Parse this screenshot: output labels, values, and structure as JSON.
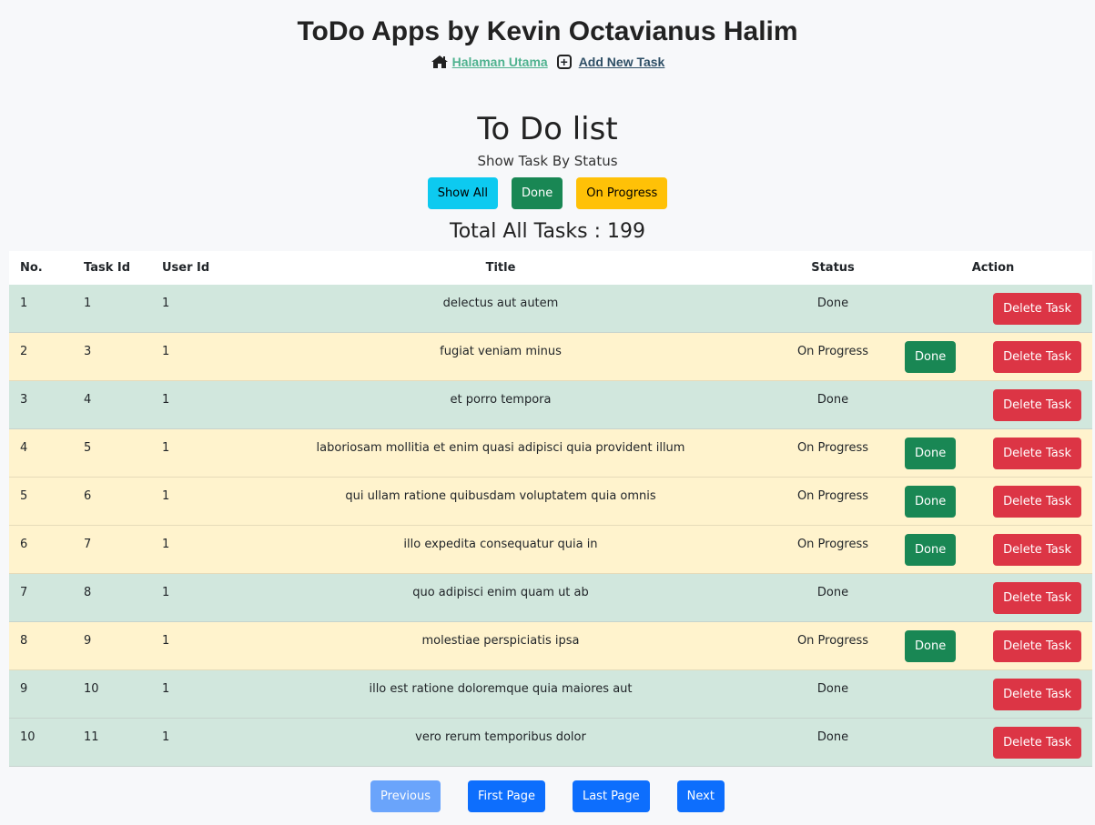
{
  "app": {
    "title": "ToDo Apps by Kevin Octavianus Halim"
  },
  "nav": {
    "home_label": "Halaman Utama",
    "add_label": "Add New Task"
  },
  "page": {
    "heading": "To Do list",
    "filter_label": "Show Task By Status",
    "total": "Total All Tasks : 199"
  },
  "filters": {
    "show_all": "Show All",
    "done": "Done",
    "on_progress": "On Progress"
  },
  "table": {
    "headers": {
      "no": "No.",
      "task_id": "Task Id",
      "user_id": "User Id",
      "title": "Title",
      "status": "Status",
      "action": "Action"
    },
    "done_button": "Done",
    "delete_button": "Delete Task",
    "rows": [
      {
        "no": "1",
        "task_id": "1",
        "user_id": "1",
        "title": "delectus aut autem",
        "status": "Done"
      },
      {
        "no": "2",
        "task_id": "3",
        "user_id": "1",
        "title": "fugiat veniam minus",
        "status": "On Progress"
      },
      {
        "no": "3",
        "task_id": "4",
        "user_id": "1",
        "title": "et porro tempora",
        "status": "Done"
      },
      {
        "no": "4",
        "task_id": "5",
        "user_id": "1",
        "title": "laboriosam mollitia et enim quasi adipisci quia provident illum",
        "status": "On Progress"
      },
      {
        "no": "5",
        "task_id": "6",
        "user_id": "1",
        "title": "qui ullam ratione quibusdam voluptatem quia omnis",
        "status": "On Progress"
      },
      {
        "no": "6",
        "task_id": "7",
        "user_id": "1",
        "title": "illo expedita consequatur quia in",
        "status": "On Progress"
      },
      {
        "no": "7",
        "task_id": "8",
        "user_id": "1",
        "title": "quo adipisci enim quam ut ab",
        "status": "Done"
      },
      {
        "no": "8",
        "task_id": "9",
        "user_id": "1",
        "title": "molestiae perspiciatis ipsa",
        "status": "On Progress"
      },
      {
        "no": "9",
        "task_id": "10",
        "user_id": "1",
        "title": "illo est ratione doloremque quia maiores aut",
        "status": "Done"
      },
      {
        "no": "10",
        "task_id": "11",
        "user_id": "1",
        "title": "vero rerum temporibus dolor",
        "status": "Done"
      }
    ]
  },
  "pagination": {
    "previous": "Previous",
    "first": "First Page",
    "last": "Last Page",
    "next": "Next"
  },
  "icons": {
    "home": "house-icon",
    "add": "plus-square-icon"
  },
  "colors": {
    "info": "#0dcaf0",
    "success": "#198754",
    "warning": "#ffc107",
    "danger": "#dc3545",
    "primary": "#0d6efd",
    "row_done": "#d1e7dd",
    "row_progress": "#fff3cd"
  }
}
